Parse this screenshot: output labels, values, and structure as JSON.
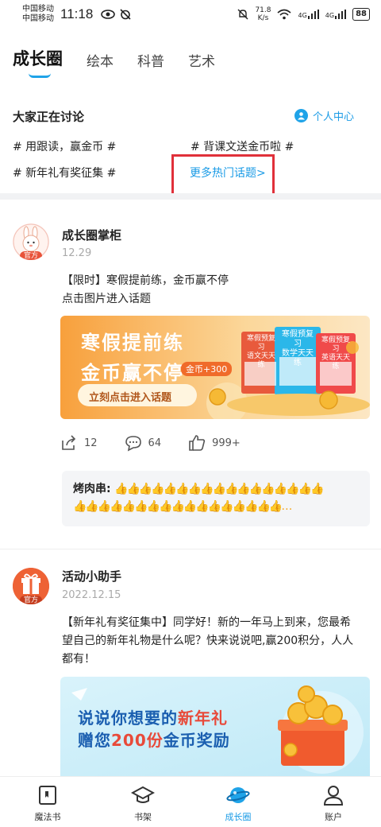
{
  "status_bar": {
    "carrier_1": "中国移动",
    "carrier_2": "中国移动",
    "time": "11:18",
    "net_speed_value": "71.8",
    "net_speed_unit": "K/s",
    "signal_1": "4G",
    "signal_2": "4G",
    "battery": "88"
  },
  "tabs": [
    {
      "label": "成长圈",
      "active": true
    },
    {
      "label": "绘本"
    },
    {
      "label": "科普"
    },
    {
      "label": "艺术"
    }
  ],
  "discuss": {
    "title": "大家正在讨论",
    "personal_center": "个人中心",
    "topics": [
      "# 用跟读，赢金币 #",
      "# 背课文送金币啦 #",
      "# 新年礼有奖征集 #"
    ],
    "more_topics": "更多热门话题>"
  },
  "post1": {
    "author": "成长圈掌柜",
    "badge": "官方",
    "date": "12.29",
    "text_line1": "【限时】寒假提前练，金币赢不停",
    "text_line2": "点击图片进入话题",
    "banner": {
      "headline1": "寒假提前练",
      "headline2": "金币赢不停",
      "coin_tag": "金币+300",
      "cta": "立刻点击进入话题",
      "book1": "寒假预复习\n语文天天练",
      "book2": "寒假预复习\n数学天天练",
      "book3": "寒假预复习\n英语天天练"
    },
    "shares": "12",
    "comments": "64",
    "likes": "999+",
    "comment_author": "烤肉串:",
    "comment_line1": "👍👍👍👍👍👍👍👍👍👍👍👍👍👍👍👍👍",
    "comment_line2": "👍👍👍👍👍👍👍👍👍👍👍👍👍👍👍👍👍…"
  },
  "post2": {
    "author": "活动小助手",
    "badge": "官方",
    "date": "2022.12.15",
    "text_line1": "【新年礼有奖征集中】同学好！新的一年马上到来，您最希",
    "text_line2": "望自己的新年礼物是什么呢？快来说说吧,赢200积分，人人",
    "text_line3": "都有！",
    "banner": {
      "line1_a": "说说你想要的",
      "line1_b": "新年礼",
      "line2_a": "赠您",
      "line2_b": "200份",
      "line2_c": "金币奖励"
    }
  },
  "bottom_nav": [
    {
      "label": "魔法书",
      "icon": "magic-book-icon"
    },
    {
      "label": "书架",
      "icon": "graduation-cap-icon"
    },
    {
      "label": "成长圈",
      "icon": "growth-planet-icon",
      "active": true
    },
    {
      "label": "账户",
      "icon": "account-icon"
    }
  ],
  "colors": {
    "accent": "#1a9be6",
    "highlight_box": "#e0303a",
    "badge": "#e8533a",
    "thumb": "#f3a51a"
  }
}
